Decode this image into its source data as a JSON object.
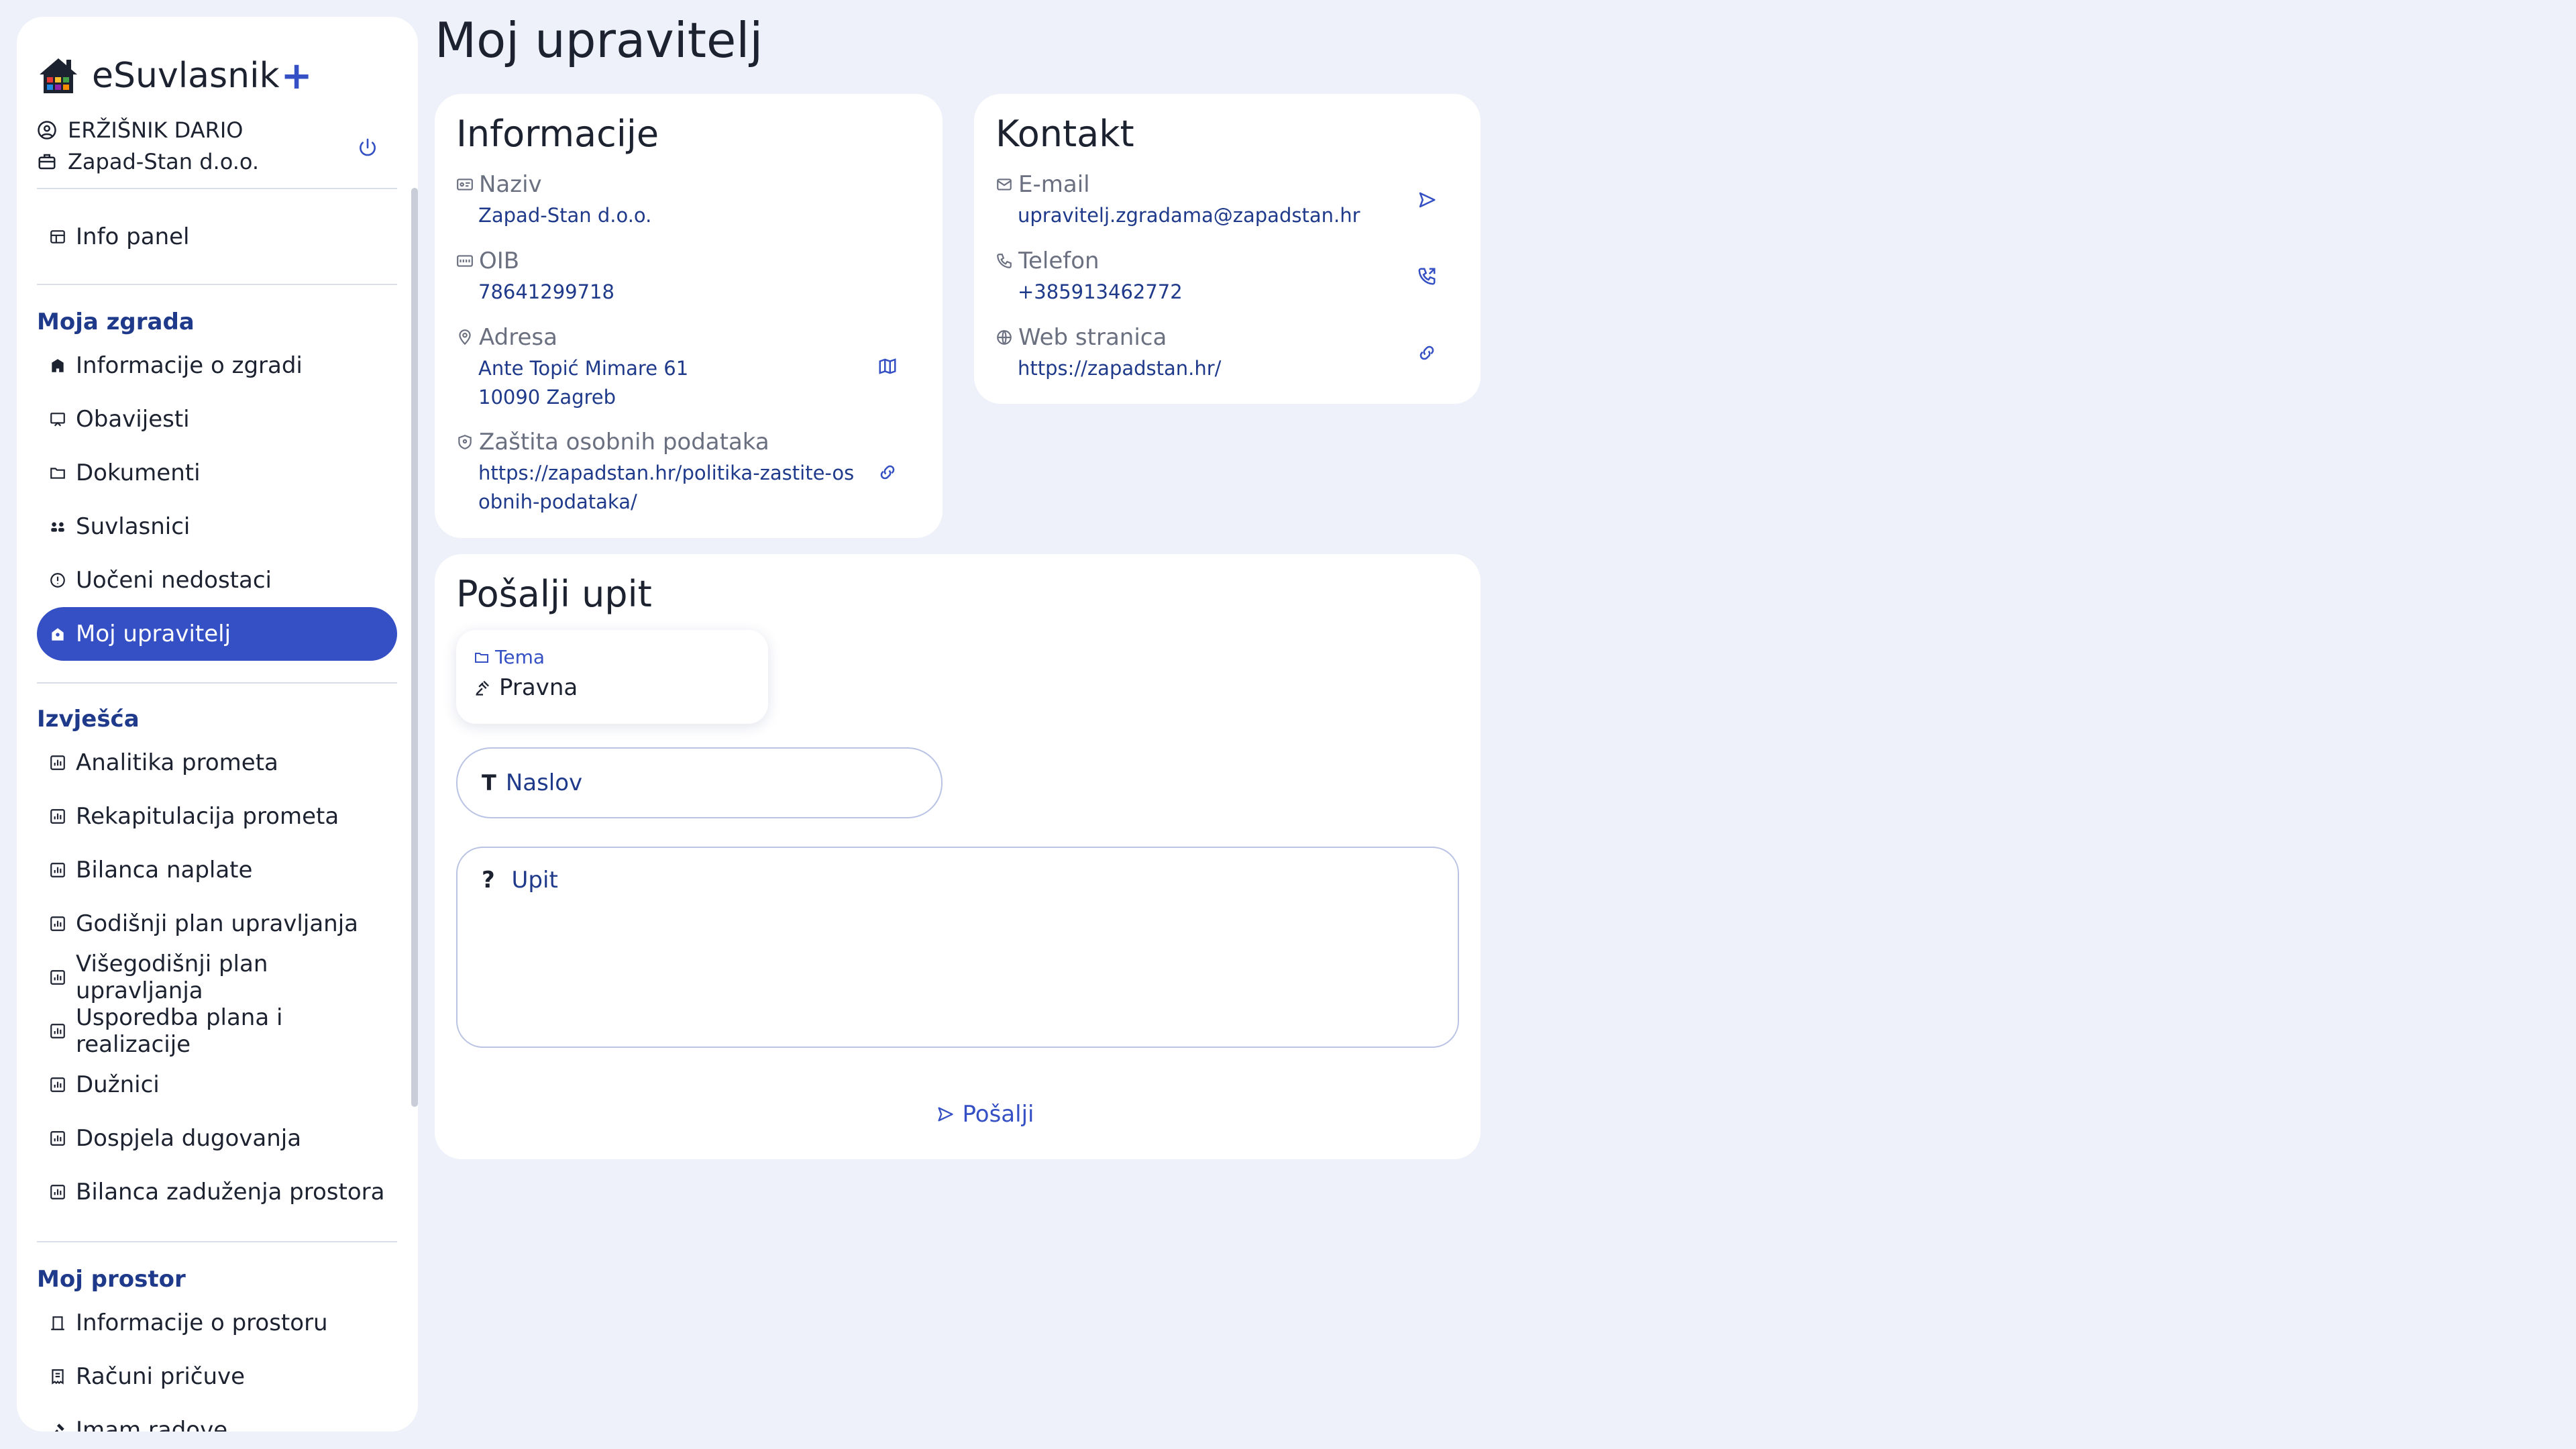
{
  "app": {
    "name": "eSuvlasnik",
    "name_suffix": "+"
  },
  "user": {
    "name": "ERŽIŠNIK DARIO",
    "company": "Zapad-Stan d.o.o."
  },
  "nav": {
    "info_panel": "Info panel",
    "sections": [
      {
        "title": "Moja zgrada",
        "items": [
          {
            "label": "Informacije o zgradi",
            "icon": "building-icon"
          },
          {
            "label": "Obavijesti",
            "icon": "notice-icon"
          },
          {
            "label": "Dokumenti",
            "icon": "folder-icon"
          },
          {
            "label": "Suvlasnici",
            "icon": "owners-icon"
          },
          {
            "label": "Uočeni nedostaci",
            "icon": "alert-icon"
          },
          {
            "label": "Moj upravitelj",
            "icon": "manager-icon",
            "active": true
          }
        ]
      },
      {
        "title": "Izvješća",
        "items": [
          {
            "label": "Analitika prometa",
            "icon": "report-icon"
          },
          {
            "label": "Rekapitulacija prometa",
            "icon": "report-icon"
          },
          {
            "label": "Bilanca naplate",
            "icon": "report-icon"
          },
          {
            "label": "Godišnji plan upravljanja",
            "icon": "report-icon"
          },
          {
            "label": "Višegodišnji plan upravljanja",
            "icon": "report-icon"
          },
          {
            "label": "Usporedba plana i realizacije",
            "icon": "report-icon"
          },
          {
            "label": "Dužnici",
            "icon": "report-icon"
          },
          {
            "label": "Dospjela dugovanja",
            "icon": "report-icon"
          },
          {
            "label": "Bilanca zaduženja prostora",
            "icon": "report-icon"
          }
        ]
      },
      {
        "title": "Moj prostor",
        "items": [
          {
            "label": "Informacije o prostoru",
            "icon": "door-icon"
          },
          {
            "label": "Računi pričuve",
            "icon": "receipt-icon"
          },
          {
            "label": "Imam radove",
            "icon": "tools-icon"
          }
        ]
      }
    ]
  },
  "page": {
    "title": "Moj upravitelj"
  },
  "info_card": {
    "title": "Informacije",
    "naziv_label": "Naziv",
    "naziv_value": "Zapad-Stan d.o.o.",
    "oib_label": "OIB",
    "oib_value": "78641299718",
    "adresa_label": "Adresa",
    "adresa_line1": "Ante Topić Mimare 61",
    "adresa_line2": "10090 Zagreb",
    "privacy_label": "Zaštita osobnih podataka",
    "privacy_line1": "https://zapadstan.hr/politika-zastite-os",
    "privacy_line2": "obnih-podataka/"
  },
  "contact_card": {
    "title": "Kontakt",
    "email_label": "E-mail",
    "email_value": "upravitelj.zgradama@zapadstan.hr",
    "phone_label": "Telefon",
    "phone_value": "+385913462772",
    "web_label": "Web stranica",
    "web_value": "https://zapadstan.hr/"
  },
  "inquiry": {
    "title": "Pošalji upit",
    "tema_label": "Tema",
    "tema_value": "Pravna",
    "naslov_placeholder": "Naslov",
    "upit_placeholder": "Upit",
    "send_label": "Pošalji"
  },
  "colors": {
    "accent": "#3550c4",
    "link": "#1f3a8a",
    "background": "#eef1f9"
  }
}
